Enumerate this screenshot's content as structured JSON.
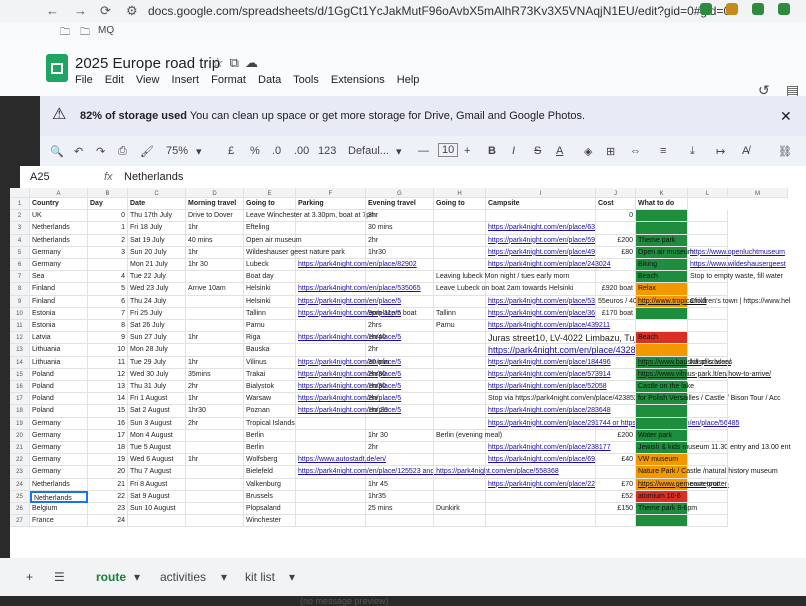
{
  "browser": {
    "url": "docs.google.com/spreadsheets/d/1GgCt1YcJakMutF96oAvbX5mAlhR73Kv3X5VNAqjN1EU/edit?gid=0#gid=0",
    "bookmark": "MQ"
  },
  "document": {
    "title": "2025 Europe road trip"
  },
  "menu": [
    "File",
    "Edit",
    "View",
    "Insert",
    "Format",
    "Data",
    "Tools",
    "Extensions",
    "Help"
  ],
  "banner": {
    "text_bold": "82% of storage used",
    "text": "You can clean up space or get more storage for Drive, Gmail and Google Photos."
  },
  "toolbar": {
    "zoom": "75%",
    "currency": "£",
    "percent": "%",
    "dec_less": ".0",
    "dec_more": ".00",
    "number_format": "123",
    "font": "Defaul...",
    "minus": "—",
    "font_size": "10",
    "bold": "B",
    "italic": "I",
    "strike": "S",
    "text_color": "A"
  },
  "formula_bar": {
    "cell_ref": "A25",
    "fx": "fx",
    "value": "Netherlands"
  },
  "sheet": {
    "col_letters": [
      "A",
      "B",
      "C",
      "D",
      "E",
      "F",
      "G",
      "H",
      "I",
      "J",
      "K",
      "L",
      "M"
    ],
    "headers": [
      "Country",
      "Day",
      "Date",
      "Morning travel",
      "Going to",
      "Parking",
      "Evening travel",
      "Going to",
      "Campsite",
      "Cost",
      "What to do"
    ],
    "row_numbers": [
      "1",
      "2",
      "3",
      "4",
      "5",
      "6",
      "7",
      "8",
      "9",
      "10",
      "11",
      "12",
      "13",
      "14",
      "15",
      "16",
      "17",
      "18",
      "19",
      "20",
      "21",
      "22",
      "23",
      "24",
      "25",
      "26",
      "27"
    ],
    "rows": [
      {
        "country": "UK",
        "day": "0",
        "date": "Thu 17th July",
        "morning": "Drive to Dover",
        "going": "Leave Winchester at 3.30pm, boat at 7pm",
        "parking": "",
        "evening": "3hr",
        "going2": "",
        "campsite": "",
        "cost": "0",
        "todo": "",
        "todo2": ""
      },
      {
        "country": "Netherlands",
        "day": "1",
        "date": "Fri 18 July",
        "morning": "1hr",
        "going": "Efteling",
        "parking": "",
        "evening": "30 mins",
        "going2": "",
        "campsite": "https://park4night.com/en/place/63",
        "cost": "",
        "todo": "",
        "todo2": ""
      },
      {
        "country": "Netherlands",
        "day": "2",
        "date": "Sat 19 July",
        "morning": "40 mins",
        "going": "Open air museum",
        "parking": "",
        "evening": "2hr",
        "going2": "",
        "campsite": "https://park4night.com/en/place/59",
        "cost": "£200",
        "todo": "Theme park",
        "todo2": ""
      },
      {
        "country": "Germany",
        "day": "3",
        "date": "Sun 20 July",
        "morning": "1hr",
        "going": "Wildeshauser geest nature park",
        "parking": "",
        "evening": "1hr30",
        "going2": "",
        "campsite": "https://park4night.com/en/place/49",
        "cost": "£80",
        "todo": "Open air museum",
        "todo2": "https://www.openluchtmuseum"
      },
      {
        "country": "Germany",
        "day": "",
        "date": "Mon 21 July",
        "morning": "1hr 30",
        "going": "Lubeck",
        "parking": "https://park4night.com/en/place/82902",
        "evening": "",
        "going2": "",
        "campsite": "https://park4night.com/en/place/243024",
        "cost": "",
        "todo": "Biking",
        "todo2": "https://www.wildeshausergeest"
      },
      {
        "country": "Sea",
        "day": "4",
        "date": "Tue 22 July",
        "morning": "",
        "going": "Boat day",
        "parking": "",
        "evening": "",
        "going2": "Leaving lubeck Mon night / tues early morn",
        "campsite": "",
        "cost": "",
        "todo": "Beach",
        "todo2": "Stop to empty waste, fill water"
      },
      {
        "country": "Finland",
        "day": "5",
        "date": "Wed 23 July",
        "morning": "Arrive 10am",
        "going": "Helsinki",
        "parking": "https://park4night.com/en/place/535065",
        "evening": "",
        "going2": "Leave Lubeck on boat 2am towards Helsinki",
        "campsite": "",
        "cost": "£920 boat",
        "todo": "Relax",
        "todo2": ""
      },
      {
        "country": "Finland",
        "day": "6",
        "date": "Thu 24 July",
        "morning": "",
        "going": "Helsinki",
        "parking": "https://park4night.com/en/place/5",
        "evening": "",
        "going2": "",
        "campsite": "https://park4night.com/en/place/53",
        "cost": "55euros / 40 aun",
        "todo": "http://www.tropicario.fi",
        "todo2": "Children's town | https://www.hel"
      },
      {
        "country": "Estonia",
        "day": "7",
        "date": "Fri 25 July",
        "morning": "",
        "going": "Tallinn",
        "parking": "https://park4night.com/en/place/5",
        "evening": "9pm-11pm boat",
        "going2": "Tallinn",
        "campsite": "https://park4night.com/en/place/36",
        "cost": "£170 boat",
        "todo": "",
        "todo2": ""
      },
      {
        "country": "Estonia",
        "day": "8",
        "date": "Sat 26 July",
        "morning": "",
        "going": "Parnu",
        "parking": "",
        "evening": "2hrs",
        "going2": "Parnu",
        "campsite": "https://park4night.com/en/place/439211",
        "cost": "",
        "todo": "",
        "todo2": ""
      },
      {
        "country": "Latvia",
        "day": "9",
        "date": "Sun 27 July",
        "morning": "1hr",
        "going": "Riga",
        "parking": "https://park4night.com/en/place/5",
        "evening": "1hr40",
        "going2": "",
        "campsite": "Juras street10, LV-4022 Limbazu, Tuja",
        "cost": "",
        "todo": "Beach",
        "todo2": ""
      },
      {
        "country": "Lithuania",
        "day": "10",
        "date": "Mon 28 July",
        "morning": "",
        "going": "Bauska",
        "parking": "",
        "evening": "2hr",
        "going2": "",
        "campsite": "https://park4night.com/en/place/432895",
        "cost": "",
        "todo": "",
        "todo2": ""
      },
      {
        "country": "Lithuania",
        "day": "11",
        "date": "Tue 29 July",
        "morning": "1hr",
        "going": "Vilinus",
        "parking": "https://park4night.com/en/place/5",
        "evening": "30 min",
        "going2": "",
        "campsite": "https://park4night.com/en/place/184496",
        "cost": "",
        "todo": "https://www.bauskaspils.lv/en/",
        "todo2": "hill of crosses"
      },
      {
        "country": "Poland",
        "day": "12",
        "date": "Wed 30 July",
        "morning": "35mins",
        "going": "Trakai",
        "parking": "https://park4night.com/en/place/5",
        "evening": "2hr30",
        "going2": "",
        "campsite": "https://park4night.com/en/place/573914",
        "cost": "",
        "todo": "https://www.vilnius-park.lt/en/how-to-arrive/",
        "todo2": ""
      },
      {
        "country": "Poland",
        "day": "13",
        "date": "Thu 31 July",
        "morning": "2hr",
        "going": "Bialystok",
        "parking": "https://park4night.com/en/place/5",
        "evening": "1hr30",
        "going2": "",
        "campsite": "https://park4night.com/en/place/52058",
        "cost": "",
        "todo": "Castle on the lake",
        "todo2": ""
      },
      {
        "country": "Poland",
        "day": "14",
        "date": "Fri 1 August",
        "morning": "1hr",
        "going": "Warsaw",
        "parking": "https://park4night.com/en/place/5",
        "evening": "2hr",
        "going2": "",
        "campsite": "Stop via https://park4night.com/en/place/423852",
        "cost": "",
        "todo": "for Polish Versailles / Castle / Bison Tour / Acc",
        "todo2": ""
      },
      {
        "country": "Poland",
        "day": "15",
        "date": "Sat 2 August",
        "morning": "1hr30",
        "going": "Poznan",
        "parking": "https://park4night.com/en/place/5",
        "evening": "1hr 30",
        "going2": "",
        "campsite": "https://park4night.com/en/place/283648",
        "cost": "",
        "todo": "",
        "todo2": ""
      },
      {
        "country": "Germany",
        "day": "16",
        "date": "Sun 3 August",
        "morning": "2hr",
        "going": "Tropical Islands",
        "parking": "",
        "evening": "",
        "going2": "",
        "campsite": "https://park4night.com/en/place/291744 or https://park4night.com/en/place/56485",
        "cost": "",
        "todo": "",
        "todo2": ""
      },
      {
        "country": "Germany",
        "day": "17",
        "date": "Mon 4 August",
        "morning": "",
        "going": "Berlin",
        "parking": "",
        "evening": "1hr 30",
        "going2": "Berlin (evening meal)",
        "campsite": "",
        "cost": "£200",
        "todo": "Water park",
        "todo2": ""
      },
      {
        "country": "Germany",
        "day": "18",
        "date": "Tue 5 August",
        "morning": "",
        "going": "Berlin",
        "parking": "",
        "evening": "2hr",
        "going2": "",
        "campsite": "https://park4night.com/en/place/238177",
        "cost": "",
        "todo": "Jewish & kids museum 11.30 entry and 13.00 ent",
        "todo2": ""
      },
      {
        "country": "Germany",
        "day": "19",
        "date": "Wed 6 August",
        "morning": "1hr",
        "going": "Wolfsberg",
        "parking": "https://www.autostadt.de/en/",
        "evening": "",
        "going2": "",
        "campsite": "https://park4night.com/en/place/69",
        "cost": "£40",
        "todo": "VW museum",
        "todo2": ""
      },
      {
        "country": "Germany",
        "day": "20",
        "date": "Thu 7 August",
        "morning": "",
        "going": "Bielefeld",
        "parking": "https://park4night.com/en/place/125523 and https://park4night.com/en/place/558368",
        "evening": "",
        "going2": "",
        "campsite": "",
        "cost": "",
        "todo": "Nature Park / Castle /natural history museum",
        "todo2": ""
      },
      {
        "country": "Netherlands",
        "day": "21",
        "date": "Fri 8 August",
        "morning": "",
        "going": "Valkenburg",
        "parking": "",
        "evening": "1hr 45",
        "going2": "",
        "campsite": "https://park4night.com/en/place/22",
        "cost": "£70",
        "todo": "https://www.gemeentegrotten",
        "todo2": "cave tour"
      },
      {
        "country": "Netherlands",
        "day": "22",
        "date": "Sat 9 August",
        "morning": "",
        "going": "Brussels",
        "parking": "",
        "evening": "1hr35",
        "going2": "",
        "campsite": "",
        "cost": "£52",
        "todo": "atomium 10-6",
        "todo2": ""
      },
      {
        "country": "Belgium",
        "day": "23",
        "date": "Sun 10 August",
        "morning": "",
        "going": "Plopsaland",
        "parking": "",
        "evening": "25 mins",
        "going2": "Dunkirk",
        "campsite": "",
        "cost": "£150",
        "todo": "Theme park 8-6pm",
        "todo2": ""
      },
      {
        "country": "France",
        "day": "24",
        "date": "",
        "morning": "",
        "going": "Winchester",
        "parking": "",
        "evening": "",
        "going2": "",
        "campsite": "",
        "cost": "",
        "todo": "",
        "todo2": ""
      }
    ],
    "todo_colors": {
      "green": "#1e8e3e",
      "orange": "#f29900",
      "red": "#d93025"
    }
  },
  "tabs": {
    "items": [
      "route",
      "activities",
      "kit list"
    ],
    "active": "route"
  },
  "preview_text": "(no message preview)"
}
